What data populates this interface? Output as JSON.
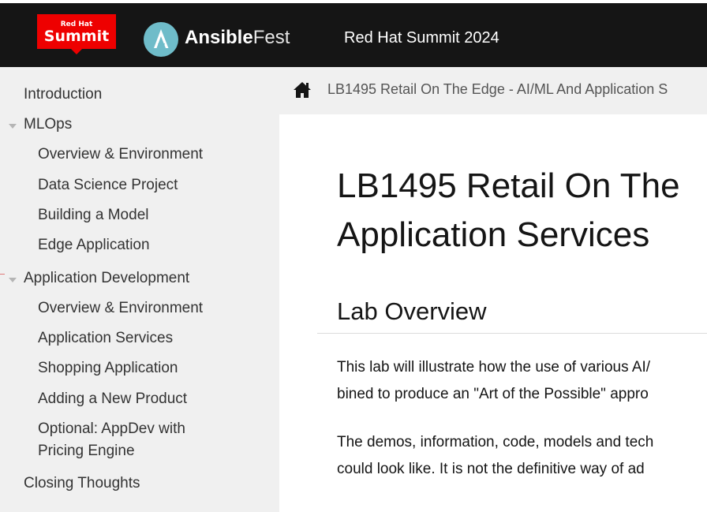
{
  "header": {
    "summit_logo_small": "Red Hat",
    "summit_logo_big": "Summit",
    "ansible_logo_bold": "Ansible",
    "ansible_logo_light": "Fest",
    "title": "Red Hat Summit 2024",
    "brand_color": "#ee0000",
    "bar_color": "#151515",
    "ansible_color": "#6fbcc9"
  },
  "sidebar": {
    "items": [
      {
        "label": "Introduction",
        "level": 1,
        "expandable": false
      },
      {
        "label": "MLOps",
        "level": 1,
        "expandable": true,
        "expanded": true
      },
      {
        "label": "Overview & Environment",
        "level": 2
      },
      {
        "label": "Data Science Project",
        "level": 2
      },
      {
        "label": "Building a Model",
        "level": 2
      },
      {
        "label": "Edge Application",
        "level": 2
      },
      {
        "label": "Application Development",
        "level": 1,
        "expandable": true,
        "expanded": true
      },
      {
        "label": "Overview & Environment",
        "level": 2
      },
      {
        "label": "Application Services",
        "level": 2
      },
      {
        "label": "Shopping Application",
        "level": 2
      },
      {
        "label": "Adding a New Product",
        "level": 2
      },
      {
        "label": "Optional: AppDev with",
        "label_line2": "Pricing Engine",
        "level": 2
      },
      {
        "label": "Closing Thoughts",
        "level": 1,
        "expandable": false
      }
    ]
  },
  "breadcrumb": {
    "home_icon": "home-icon",
    "text": "LB1495 Retail On The Edge - AI/ML And Application S"
  },
  "main": {
    "title_line1": "LB1495 Retail On The",
    "title_line2": "Application Services",
    "section_heading": "Lab Overview",
    "paragraph1_line1": "This lab will illustrate how the use of various AI/",
    "paragraph1_line2": "bined to produce an \"Art of the Possible\" appro",
    "paragraph2_line1": "The demos, information, code, models and tech",
    "paragraph2_line2": "could look like. It is not the definitive way of ad"
  }
}
